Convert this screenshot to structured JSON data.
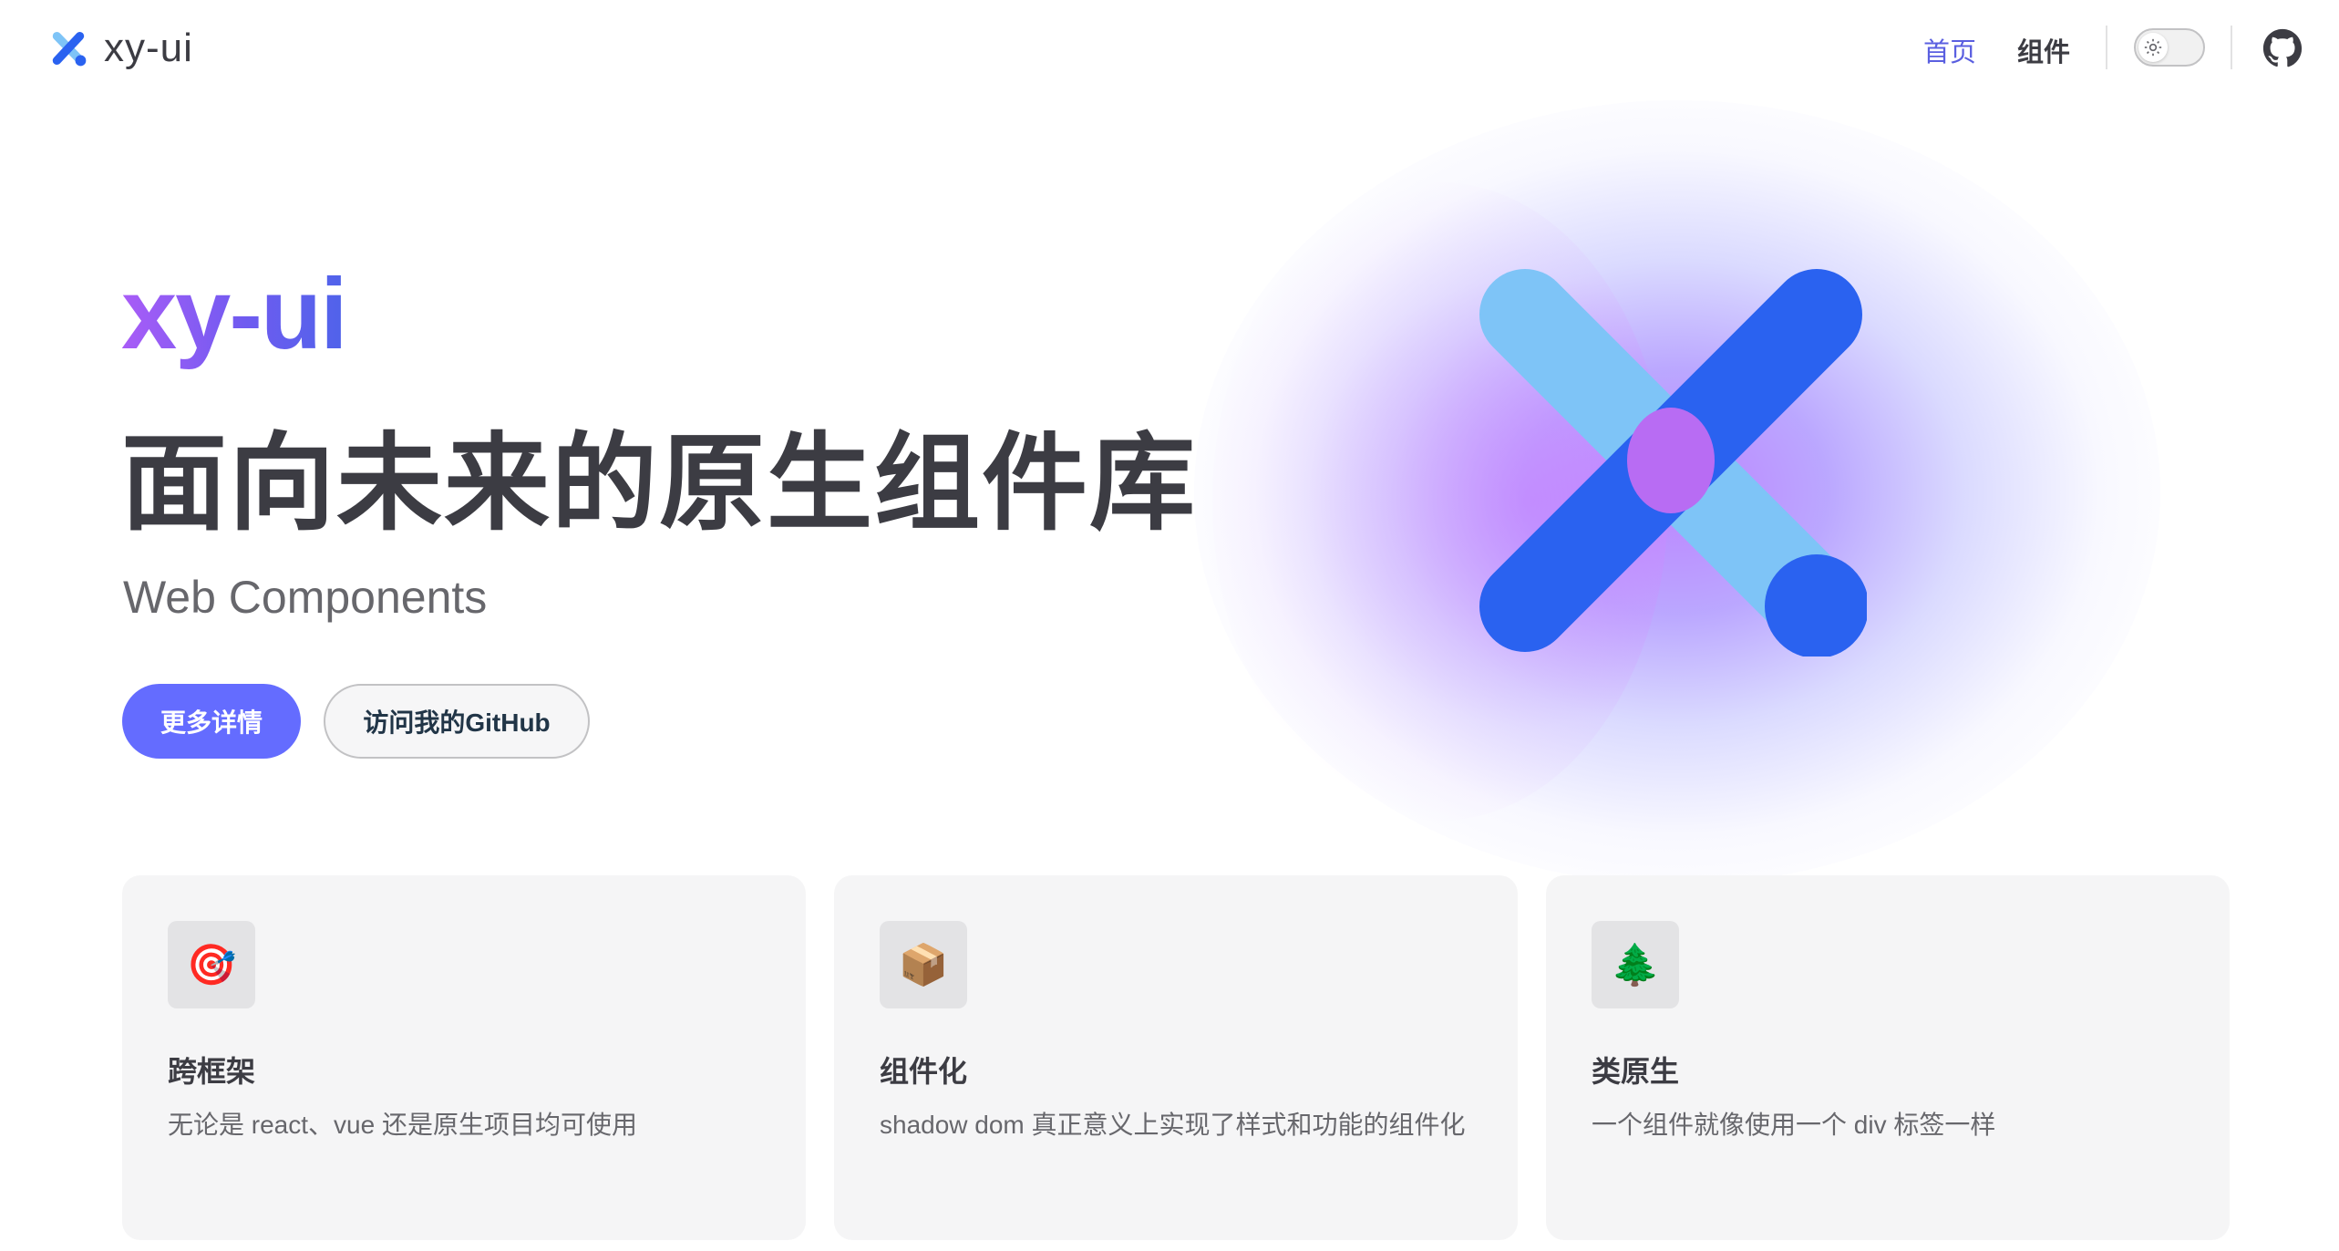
{
  "navbar": {
    "brand_title": "xy-ui",
    "nav_home": "首页",
    "nav_components": "组件"
  },
  "hero": {
    "name": "xy-ui",
    "text": "面向未来的原生组件库",
    "tagline": "Web Components",
    "primary_action": "更多详情",
    "alt_action": "访问我的GitHub"
  },
  "features": [
    {
      "icon": "🎯",
      "icon_name": "target-icon",
      "title": "跨框架",
      "details": "无论是 react、vue 还是原生项目均可使用"
    },
    {
      "icon": "📦",
      "icon_name": "package-icon",
      "title": "组件化",
      "details": "shadow dom 真正意义上实现了样式和功能的组件化"
    },
    {
      "icon": "🌲",
      "icon_name": "tree-icon",
      "title": "类原生",
      "details": "一个组件就像使用一个 div 标签一样"
    }
  ],
  "colors": {
    "brand": "#646cff",
    "logo_dark_blue": "#2a62f0",
    "logo_light_blue": "#7ec4f7",
    "logo_overlap": "#b86cf3"
  }
}
